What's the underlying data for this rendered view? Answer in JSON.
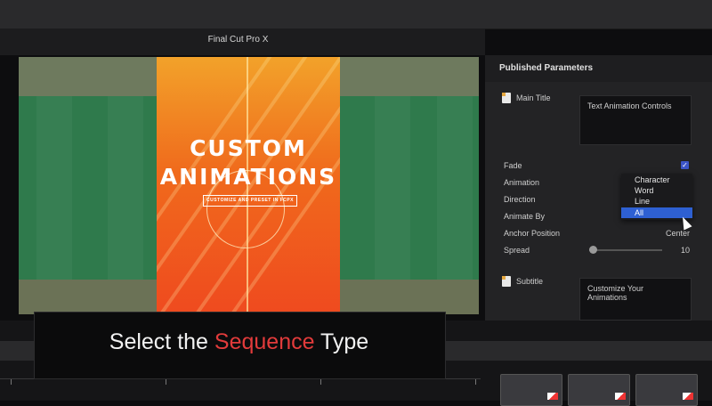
{
  "app": {
    "title": "Final Cut Pro X"
  },
  "viewer": {
    "poster_line1": "CUSTOM",
    "poster_line2": "ANIMATIONS",
    "poster_sub": "CUSTOMIZE AND PRESET IN FCPX"
  },
  "inspector": {
    "title": "Published Parameters",
    "main_title_label": "Main Title",
    "main_title_value": "Text Animation Controls",
    "params": [
      {
        "label": "Fade"
      },
      {
        "label": "Animation"
      },
      {
        "label": "Direction"
      },
      {
        "label": "Animate By"
      },
      {
        "label": "Anchor Position",
        "value": "Center"
      },
      {
        "label": "Spread",
        "value": "10"
      }
    ],
    "fade_checked": true,
    "animate_by_options": [
      "Character",
      "Word",
      "Line",
      "All"
    ],
    "animate_by_selected": "All",
    "subtitle_label": "Subtitle",
    "subtitle_value": "Customize Your Animations"
  },
  "caption": {
    "prefix": "Select the ",
    "accent": "Sequence",
    "suffix": " Type",
    "accent_color": "#e23b3b"
  }
}
